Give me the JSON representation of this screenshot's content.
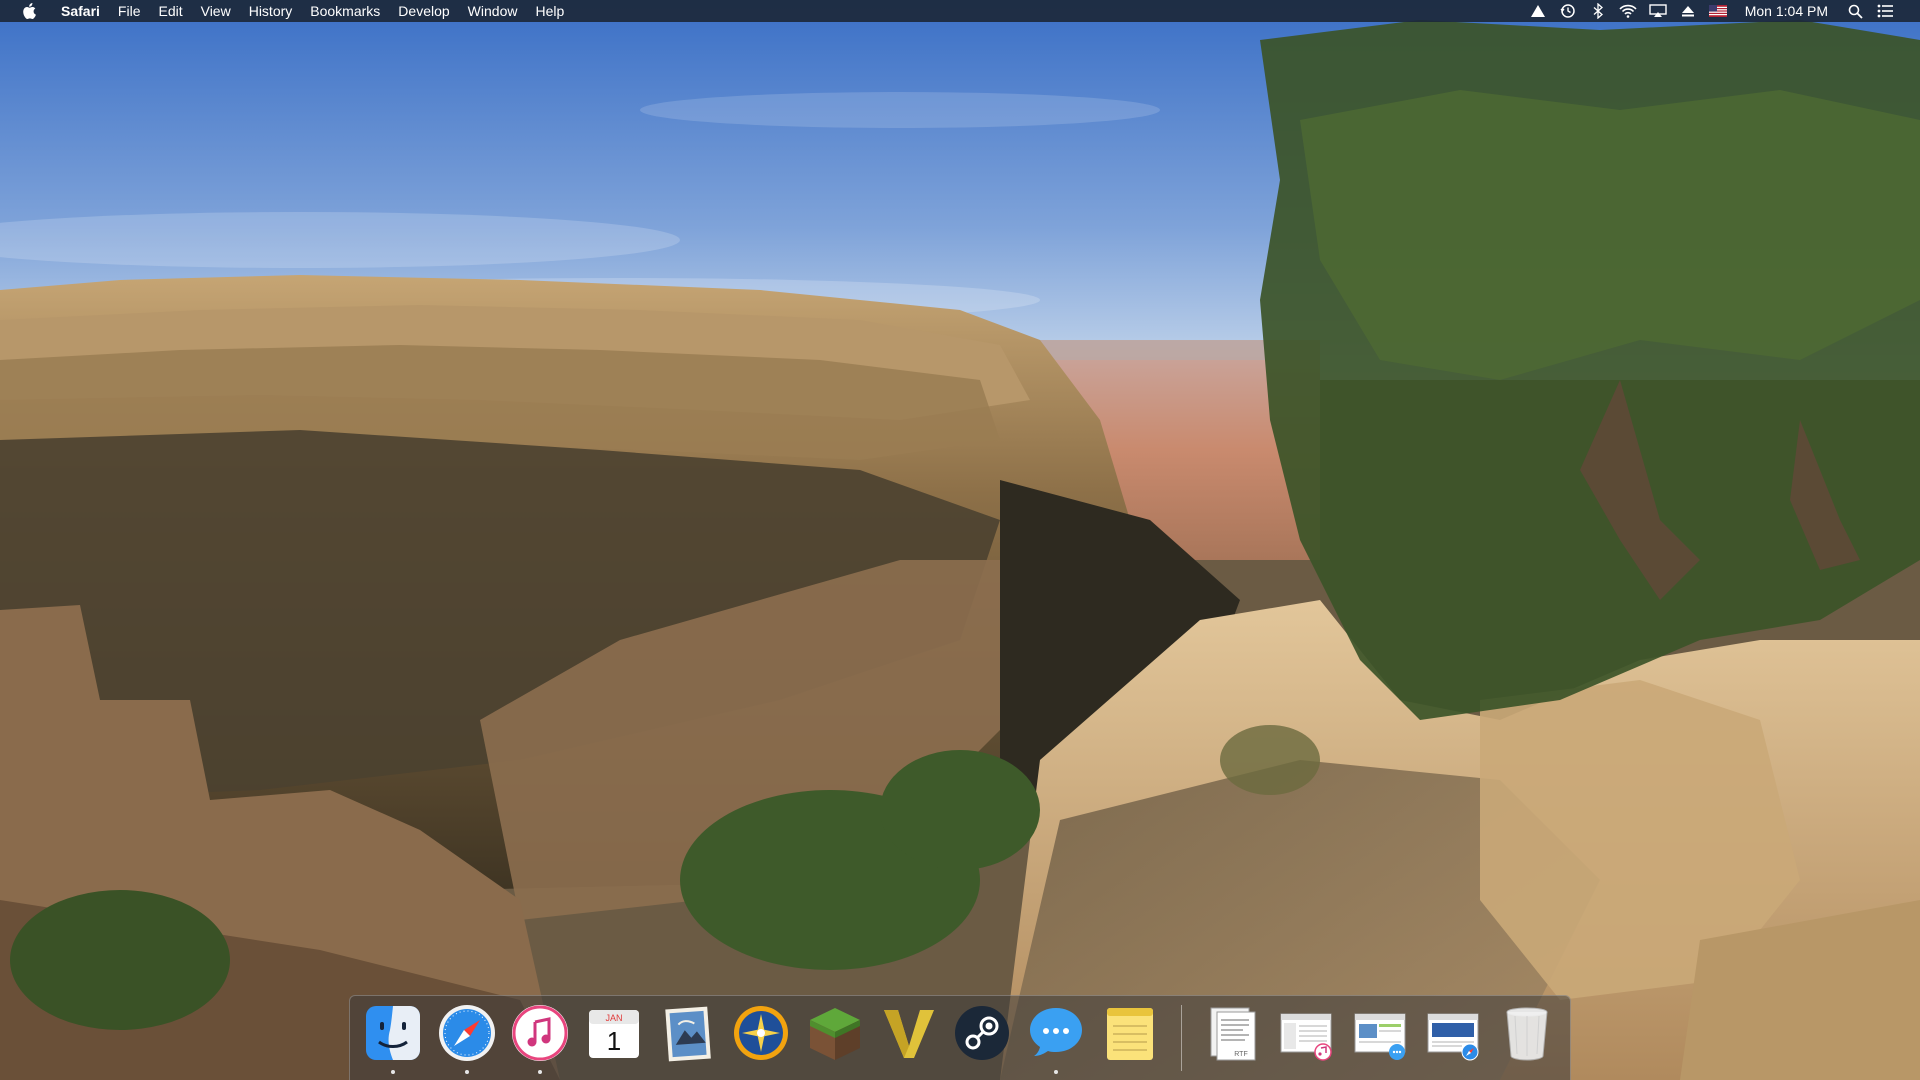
{
  "menubar": {
    "app_name": "Safari",
    "menus": [
      "File",
      "Edit",
      "View",
      "History",
      "Bookmarks",
      "Develop",
      "Window",
      "Help"
    ],
    "status_icons": [
      "drive-triangle-icon",
      "time-machine-icon",
      "bluetooth-icon",
      "wifi-icon",
      "airplay-icon",
      "eject-icon",
      "us-flag-input-icon"
    ],
    "clock": "Mon 1:04 PM",
    "right_icons": [
      "spotlight-search-icon",
      "notification-center-icon"
    ]
  },
  "dock": {
    "apps": [
      {
        "name": "finder",
        "running": true
      },
      {
        "name": "safari",
        "running": true
      },
      {
        "name": "itunes",
        "running": true
      },
      {
        "name": "calendar",
        "running": false,
        "month": "JAN",
        "day": "1"
      },
      {
        "name": "mail",
        "running": false
      },
      {
        "name": "launchpad-compass",
        "running": false
      },
      {
        "name": "minecraft",
        "running": false
      },
      {
        "name": "vectorize-v",
        "running": false
      },
      {
        "name": "steam",
        "running": false
      },
      {
        "name": "messages",
        "running": true
      },
      {
        "name": "notes",
        "running": false
      }
    ],
    "documents": [
      {
        "name": "rtf-document",
        "label": "RTF"
      },
      {
        "name": "itunes-document-thumbnail"
      },
      {
        "name": "messages-document-thumbnail"
      },
      {
        "name": "safari-document-thumbnail"
      }
    ],
    "trash": {
      "name": "trash"
    }
  },
  "colors": {
    "menubar_bg": "#1c283a",
    "sky_top": "#3f72c8",
    "sky_bottom": "#b6cce6",
    "rock": "#b38a5b",
    "shadow_rock": "#3c3424",
    "tree": "#3f5b2a"
  }
}
